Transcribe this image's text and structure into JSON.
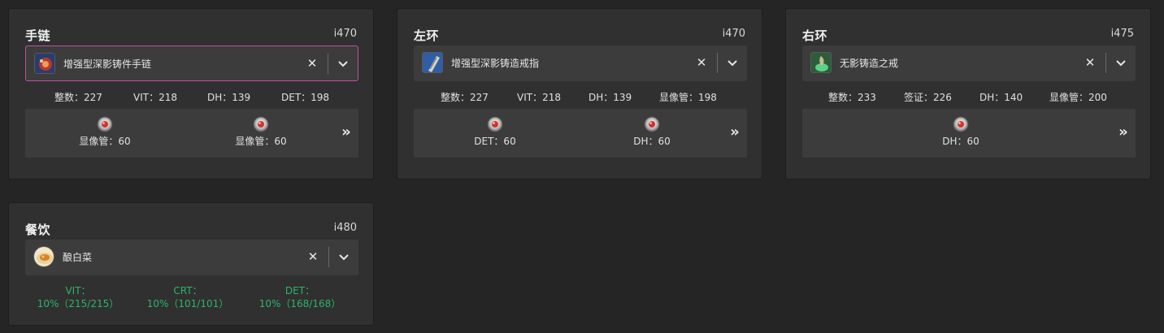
{
  "colors": {
    "background": "#252525",
    "card": "#303030",
    "select": "#3c3c3c",
    "active_border": "#c24fa0",
    "food_stat": "#2eb36c"
  },
  "bracelet": {
    "title": "手链",
    "ilvl": "i470",
    "item": {
      "name": "增强型深影铸件手链",
      "icon": "bracelet-icon"
    },
    "stats": [
      "整数：227",
      "VIT：218",
      "DH：139",
      "DET：198"
    ],
    "materia": [
      {
        "label": "显像管：60",
        "icon": "materia-icon"
      },
      {
        "label": "显像管：60",
        "icon": "materia-icon"
      }
    ],
    "more": "»"
  },
  "left_ring": {
    "title": "左环",
    "ilvl": "i470",
    "item": {
      "name": "增强型深影铸造戒指",
      "icon": "ring-icon"
    },
    "stats": [
      "整数：227",
      "VIT：218",
      "DH：139",
      "显像管：198"
    ],
    "materia": [
      {
        "label": "DET：60",
        "icon": "materia-icon"
      },
      {
        "label": "DH：60",
        "icon": "materia-icon"
      }
    ],
    "more": "»"
  },
  "right_ring": {
    "title": "右环",
    "ilvl": "i475",
    "item": {
      "name": "无影铸造之戒",
      "icon": "ring-icon"
    },
    "stats": [
      "整数：233",
      "签证：226",
      "DH：140",
      "显像管：200"
    ],
    "materia": [
      {
        "label": "DH：60",
        "icon": "materia-icon"
      }
    ],
    "more": "»"
  },
  "food": {
    "title": "餐饮",
    "ilvl": "i480",
    "item": {
      "name": "酿白菜",
      "icon": "food-icon"
    },
    "stats": [
      {
        "name": "VIT：",
        "value": "10%（215/215）"
      },
      {
        "name": "CRT：",
        "value": "10%（101/101）"
      },
      {
        "name": "DET：",
        "value": "10%（168/168）"
      }
    ]
  },
  "controls": {
    "clear": "✕"
  }
}
